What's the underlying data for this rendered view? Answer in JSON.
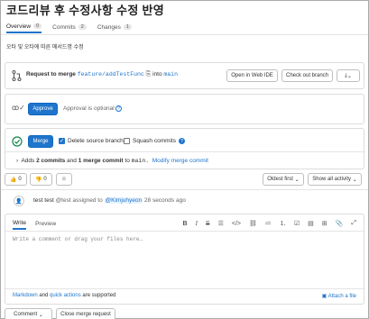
{
  "title": "코드리뷰 후 수정사항 수정 반영",
  "tabs": [
    {
      "label": "Overview",
      "count": "0"
    },
    {
      "label": "Commits",
      "count": "2"
    },
    {
      "label": "Changes",
      "count": "1"
    }
  ],
  "description": "오타 및 오타에 따른 메서드명 수정",
  "merge_request": {
    "request_label": "Request to merge",
    "source_branch": "feature/addTestFunc",
    "into_label": "into",
    "target_branch": "main",
    "open_web_ide": "Open in Web IDE",
    "checkout_branch": "Check out branch"
  },
  "approval": {
    "approve_label": "Approve",
    "optional_text": "Approval is optional"
  },
  "merge": {
    "merge_label": "Merge",
    "delete_source": "Delete source branch",
    "squash": "Squash commits",
    "adds_prefix": "Adds",
    "commits_bold": "2 commits",
    "and_text": "and",
    "merge_commit_bold": "1 merge commit",
    "to_text": "to",
    "target": "main.",
    "modify_link": "Modify merge commit"
  },
  "reactions": {
    "thumbs_up": "0",
    "thumbs_down": "0"
  },
  "sort": {
    "oldest_first": "Oldest first",
    "show_all": "Show all activity"
  },
  "activity": {
    "author": "test test",
    "handle": "@test",
    "action": "assigned to",
    "assignee": "@Kimjuhyeon",
    "time": "28 seconds ago"
  },
  "editor": {
    "write_tab": "Write",
    "preview_tab": "Preview",
    "placeholder": "Write a comment or drag your files here…",
    "markdown_link": "Markdown",
    "and_text": "and",
    "quick_actions_link": "quick actions",
    "supported_text": "are supported",
    "attach_file": "Attach a file"
  },
  "footer": {
    "comment_label": "Comment",
    "close_mr": "Close merge request"
  },
  "colors": {
    "accent": "#1f75cb",
    "success": "#108548"
  }
}
